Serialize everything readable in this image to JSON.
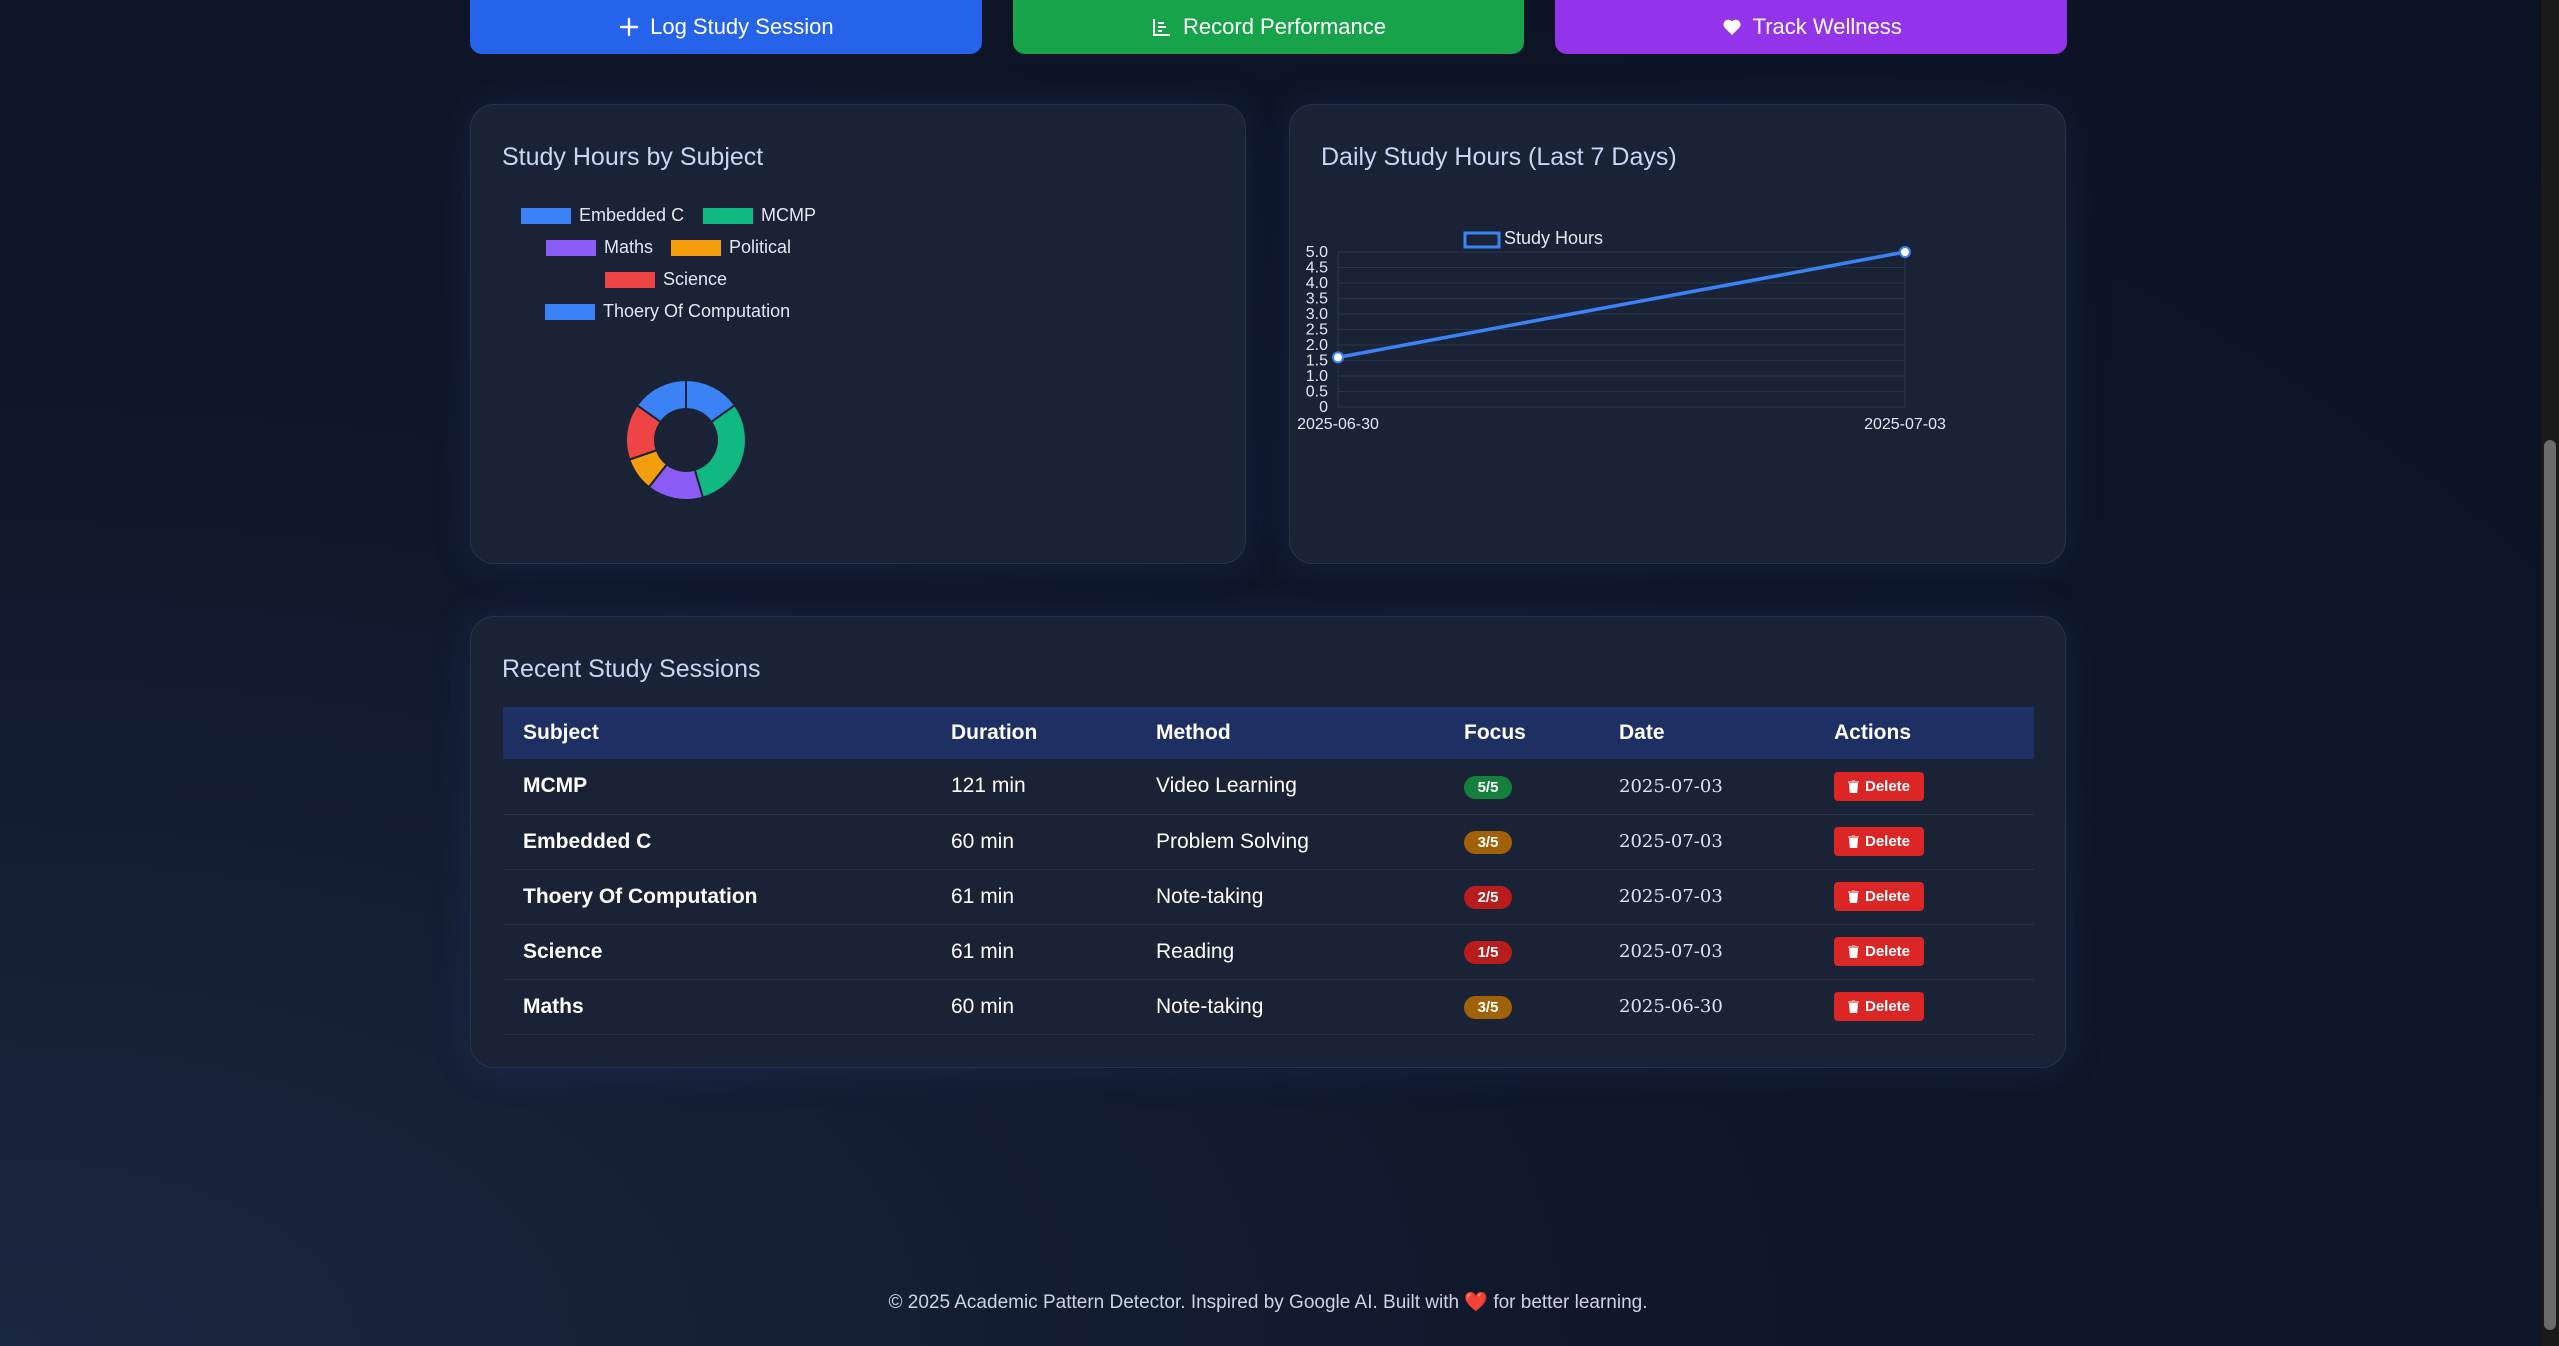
{
  "actions": {
    "log": "Log Study Session",
    "record": "Record Performance",
    "wellness": "Track Wellness"
  },
  "pie_card": {
    "title": "Study Hours by Subject"
  },
  "line_card": {
    "title": "Daily Study Hours (Last 7 Days)"
  },
  "chart_data": [
    {
      "type": "pie",
      "title": "Study Hours by Subject",
      "donut": true,
      "legend_position": "top",
      "categories": [
        "Embedded C",
        "MCMP",
        "Maths",
        "Political",
        "Science",
        "Thoery Of Computation"
      ],
      "values": [
        1.0,
        2.0,
        1.0,
        0.6,
        1.0,
        1.0
      ],
      "colors": [
        "#3b82f6",
        "#10b981",
        "#8b5cf6",
        "#f59e0b",
        "#ef4444",
        "#3b82f6"
      ]
    },
    {
      "type": "line",
      "title": "Daily Study Hours (Last 7 Days)",
      "x": [
        "2025-06-30",
        "2025-07-03"
      ],
      "series": [
        {
          "name": "Study Hours",
          "values": [
            1.6,
            5.0
          ],
          "color": "#3b82f6"
        }
      ],
      "ylim": [
        0,
        5
      ],
      "yticks": [
        "0",
        "0.5",
        "1.0",
        "1.5",
        "2.0",
        "2.5",
        "3.0",
        "3.5",
        "4.0",
        "4.5",
        "5.0"
      ],
      "grid": true,
      "legend_position": "top"
    }
  ],
  "table": {
    "title": "Recent Study Sessions",
    "columns": [
      "Subject",
      "Duration",
      "Method",
      "Focus",
      "Date",
      "Actions"
    ],
    "delete_label": "Delete",
    "rows": [
      {
        "subject": "MCMP",
        "duration": "121 min",
        "method": "Video Learning",
        "focus": "5/5",
        "focus_color": "#15803d",
        "date": "2025-07-03"
      },
      {
        "subject": "Embedded C",
        "duration": "60 min",
        "method": "Problem Solving",
        "focus": "3/5",
        "focus_color": "#a16207",
        "date": "2025-07-03"
      },
      {
        "subject": "Thoery Of Computation",
        "duration": "61 min",
        "method": "Note-taking",
        "focus": "2/5",
        "focus_color": "#b91c1c",
        "date": "2025-07-03"
      },
      {
        "subject": "Science",
        "duration": "61 min",
        "method": "Reading",
        "focus": "1/5",
        "focus_color": "#b91c1c",
        "date": "2025-07-03"
      },
      {
        "subject": "Maths",
        "duration": "60 min",
        "method": "Note-taking",
        "focus": "3/5",
        "focus_color": "#a16207",
        "date": "2025-06-30"
      }
    ]
  },
  "footer": {
    "before": "© 2025 Academic Pattern Detector. Inspired by Google AI. Built with",
    "after": "for better learning."
  }
}
